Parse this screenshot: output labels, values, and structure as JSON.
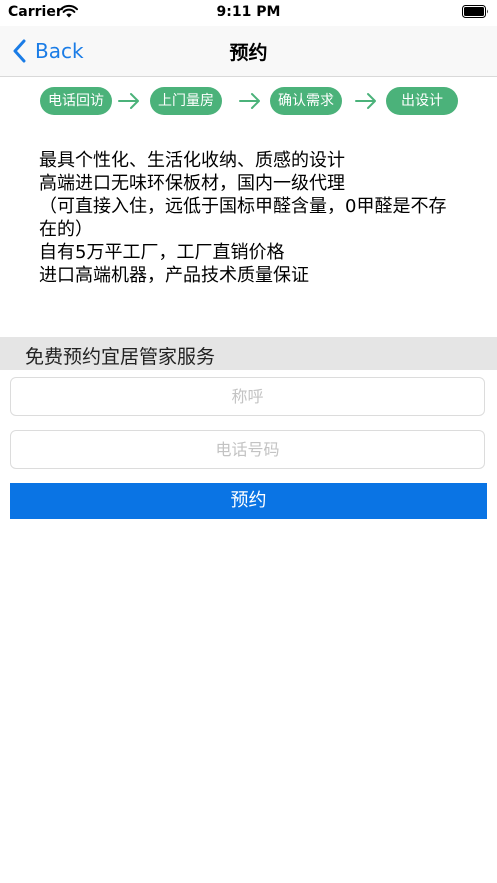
{
  "status_bar": {
    "carrier": "Carrier",
    "time": "9:11 PM"
  },
  "nav": {
    "back_label": "Back",
    "title": "预约"
  },
  "steps": [
    {
      "label": "电话回访"
    },
    {
      "label": "上门量房"
    },
    {
      "label": "确认需求"
    },
    {
      "label": "出设计"
    }
  ],
  "features": [
    "最具个性化、生活化收纳、质感的设计",
    "高端进口无味环保板材，国内一级代理",
    "（可直接入住，远低于国标甲醛含量，0甲醛是不存在的）",
    "自有5万平工厂，工厂直销价格",
    "进口高端机器，产品技术质量保证"
  ],
  "form": {
    "section_title": "免费预约宜居管家服务",
    "name_placeholder": "称呼",
    "phone_placeholder": "电话号码",
    "submit_label": "预约"
  },
  "colors": {
    "accent_blue": "#0a74e4",
    "back_blue": "#1a7ce6",
    "step_green": "#4bb27a",
    "section_bg": "#e5e5e5"
  },
  "icons": {
    "wifi": "wifi-icon",
    "battery": "battery-icon",
    "back": "chevron-left-icon",
    "arrow": "arrow-right-icon"
  }
}
